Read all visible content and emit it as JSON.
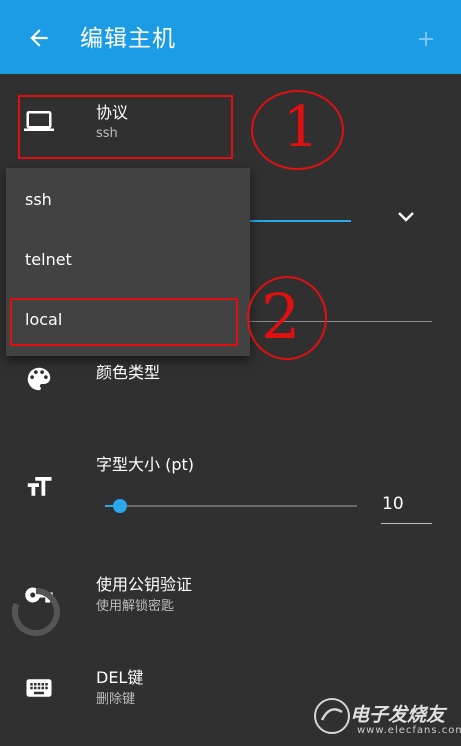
{
  "appbar": {
    "title": "编辑主机",
    "back_icon": "arrow-left-icon",
    "add_icon": "plus-icon",
    "color": "#1c9ce5"
  },
  "protocol": {
    "label": "协议",
    "value": "ssh",
    "icon": "laptop-icon"
  },
  "dropdown": {
    "options": [
      "ssh",
      "telnet",
      "local"
    ]
  },
  "annotations": {
    "one": "1",
    "two": "2"
  },
  "color_scheme": {
    "label": "颜色类型",
    "icon": "palette-icon"
  },
  "font_size": {
    "label": "字型大小 (pt)",
    "value": "10",
    "level_fraction": 0.06,
    "icon": "text-size-icon"
  },
  "pubkey": {
    "label": "使用公钥验证",
    "subtitle": "使用解锁密匙",
    "icon": "key-icon"
  },
  "del_key": {
    "label": "DEL键",
    "subtitle": "删除键",
    "icon": "keyboard-icon"
  },
  "watermark": {
    "text": "电子发烧友",
    "sub": "www.elecfans.com"
  },
  "accent": "#29a8ec",
  "annotation_color": "#e01010"
}
